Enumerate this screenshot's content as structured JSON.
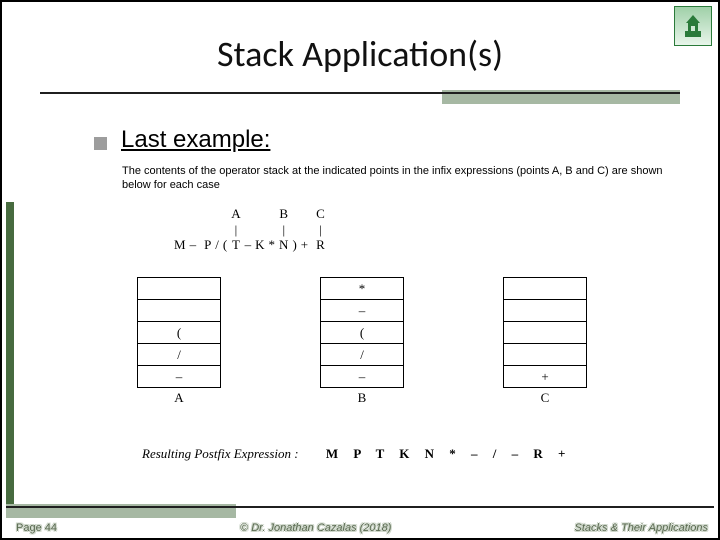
{
  "title": "Stack Application(s)",
  "section_heading": "Last example:",
  "description": "The contents of the operator stack at the indicated points in the infix expressions (points A, B and C) are shown below for each case",
  "expression": {
    "points": [
      "",
      "",
      "",
      "",
      "",
      "",
      "A",
      "",
      "",
      "",
      "B",
      "",
      "",
      "",
      "C",
      ""
    ],
    "markers": [
      "",
      "",
      "",
      "",
      "",
      "",
      "|",
      "",
      "",
      "",
      "|",
      "",
      "",
      "",
      "|",
      ""
    ],
    "tokens": [
      "M",
      "–",
      "",
      "P",
      "/",
      "(",
      "T",
      "–",
      "K",
      "*",
      "N",
      ")",
      "+",
      "",
      "R",
      ""
    ]
  },
  "stacks": [
    {
      "label": "A",
      "cells": [
        "",
        "",
        "(",
        "/",
        "–"
      ]
    },
    {
      "label": "B",
      "cells": [
        "*",
        "–",
        "(",
        "/",
        "–"
      ]
    },
    {
      "label": "C",
      "cells": [
        "",
        "",
        "",
        "",
        "+"
      ]
    }
  ],
  "result": {
    "label": "Resulting Postfix Expression :",
    "value": "M P T K N * – / – R +"
  },
  "footer": {
    "left": "Page 44",
    "center": "© Dr. Jonathan Cazalas (2018)",
    "right": "Stacks & Their Applications"
  }
}
